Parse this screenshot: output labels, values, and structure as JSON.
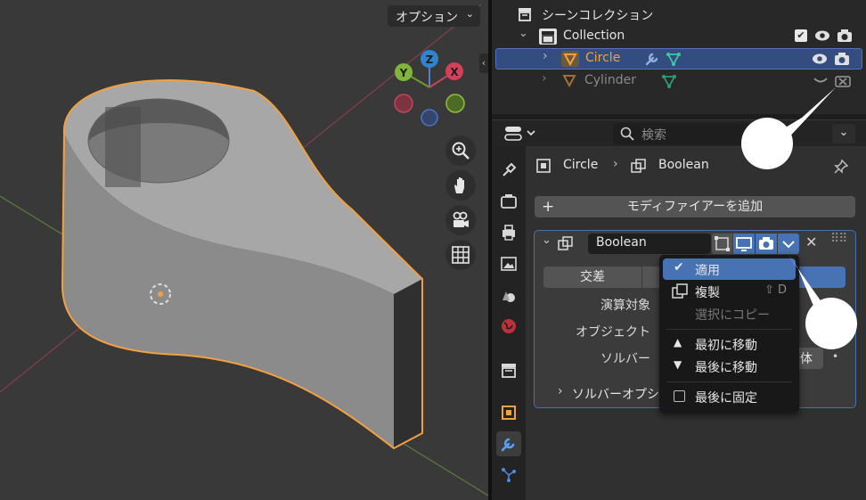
{
  "viewport": {
    "options_label": "オプション",
    "gizmo": {
      "x_label": "X",
      "y_label": "Y",
      "z_label": "Z"
    },
    "nav_icons": [
      "zoom-icon",
      "hand-icon",
      "camera-icon",
      "grid-icon"
    ],
    "colors": {
      "object_outline": "#f2a040",
      "background": "#393939",
      "x_axis": "#b24a57",
      "y_axis": "#6a9a3a"
    }
  },
  "outliner": {
    "scene_collection_label": "シーンコレクション",
    "collection_label": "Collection",
    "items": [
      {
        "label": "Circle",
        "selected": true
      },
      {
        "label": "Cylinder",
        "selected": false
      }
    ]
  },
  "properties": {
    "search_placeholder": "検索",
    "breadcrumb": {
      "object": "Circle",
      "modifier": "Boolean"
    },
    "add_modifier_label": "モディファイアーを追加",
    "modifier": {
      "name": "Boolean",
      "operation_tab": "交差",
      "operand_type_label": "演算対象",
      "object_label": "オブジェクト",
      "solver_label": "ソルバー",
      "solver_value": "体",
      "solver_options_label": "ソルバーオプシ"
    }
  },
  "dropdown_menu": {
    "items": [
      {
        "label": "適用",
        "icon": "check-icon",
        "shortcut": "",
        "disabled": false,
        "hover": true
      },
      {
        "label": "複製",
        "icon": "duplicate-icon",
        "shortcut": "⇧ D",
        "disabled": false,
        "hover": false
      },
      {
        "label": "選択にコピー",
        "icon": "",
        "shortcut": "",
        "disabled": true,
        "hover": false
      },
      {
        "label": "最初に移動",
        "icon": "triangle-up-icon",
        "shortcut": "",
        "disabled": false,
        "hover": false
      },
      {
        "label": "最後に移動",
        "icon": "triangle-down-icon",
        "shortcut": "",
        "disabled": false,
        "hover": false
      },
      {
        "label": "最後に固定",
        "icon": "checkbox-icon",
        "shortcut": "",
        "disabled": false,
        "hover": false
      }
    ]
  },
  "colors": {
    "accent": "#4772b3",
    "selected_text": "#f2a040"
  }
}
